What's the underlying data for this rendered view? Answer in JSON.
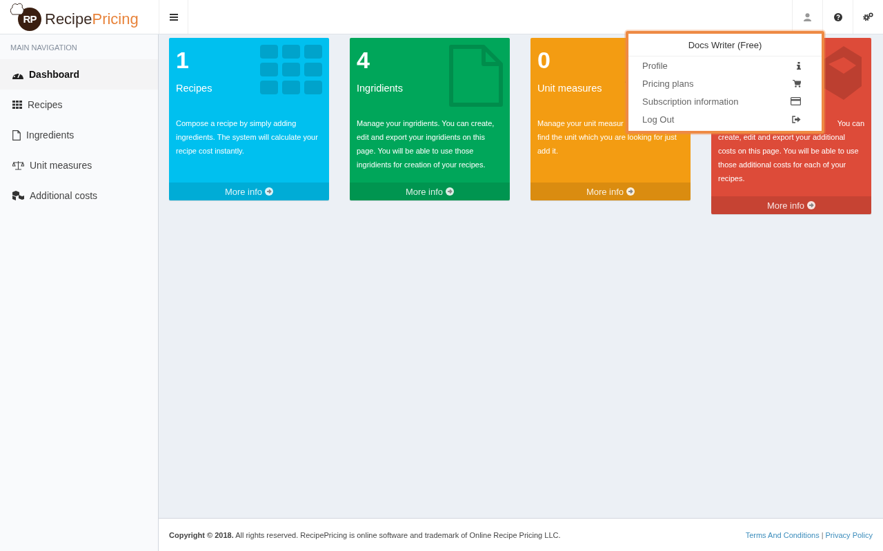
{
  "brand": {
    "initials": "RP",
    "name_main": "Recipe",
    "name_accent": "Pricing"
  },
  "sidebar": {
    "header": "MAIN NAVIGATION",
    "items": [
      {
        "label": "Dashboard",
        "kind": "dashboard",
        "selected": true
      },
      {
        "label": "Recipes",
        "kind": "grid",
        "selected": false
      },
      {
        "label": "Ingredients",
        "kind": "file",
        "selected": false
      },
      {
        "label": "Unit measures",
        "kind": "scale",
        "selected": false
      },
      {
        "label": "Additional costs",
        "kind": "cubes",
        "selected": false
      }
    ]
  },
  "cards": [
    {
      "number": "1",
      "title": "Recipes",
      "kind": "grid",
      "color": "#00c0ef",
      "lines": [
        "Compose a recipe by simply adding",
        "ingredients. The system will calculate your",
        "recipe cost instantly."
      ],
      "more": "More info"
    },
    {
      "number": "4",
      "title": "Ingridients",
      "kind": "file",
      "color": "#00a65a",
      "lines": [
        "Manage your ingridients. You can create,",
        "edit and export your ingridients on this",
        "page. You will be able to use those",
        "ingridients for creation of your recipes."
      ],
      "more": "More info"
    },
    {
      "number": "0",
      "title": "Unit measures",
      "kind": "scale",
      "color": "#f39c12",
      "lines": [
        "Manage your unit measur",
        "find the unit which you are looking for just",
        "add it."
      ],
      "more": "More info"
    },
    {
      "kind": "cubes",
      "color": "#dd4b39",
      "lines": [
        "You can",
        "create, edit and export your additional",
        "costs on this page. You will be able to use",
        "those additional costs for each of your",
        "recipes."
      ],
      "more": "More info"
    }
  ],
  "dropdown": {
    "title": "Docs Writer (Free)",
    "items": [
      {
        "label": "Profile",
        "kind": "info"
      },
      {
        "label": "Pricing plans",
        "kind": "cart"
      },
      {
        "label": "Subscription information",
        "kind": "card"
      },
      {
        "label": "Log Out",
        "kind": "logout"
      }
    ]
  },
  "footer": {
    "text": "**Copyright © 2018.** All rights reserved. RecipePricing is online software and trademark of Online Recipe Pricing LLC.",
    "links": [
      "Terms And Conditions",
      "Privacy Policy"
    ],
    "separator": "|"
  }
}
